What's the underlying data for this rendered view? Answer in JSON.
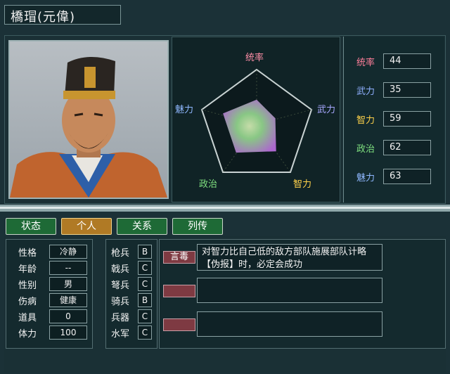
{
  "header": {
    "name": "橋瑁(元偉)"
  },
  "radar": {
    "labels": {
      "top": "统率",
      "right": "武力",
      "bottom_right": "智力",
      "bottom_left": "政治",
      "left": "魅力"
    },
    "values": {
      "统率": 44,
      "武力": 35,
      "智力": 59,
      "政治": 62,
      "魅力": 63
    }
  },
  "stats": [
    {
      "label": "统率",
      "value": "44",
      "color": "#ff7f9a"
    },
    {
      "label": "武力",
      "value": "35",
      "color": "#8fb0ff"
    },
    {
      "label": "智力",
      "value": "59",
      "color": "#ffd24a"
    },
    {
      "label": "政治",
      "value": "62",
      "color": "#7fe07f"
    },
    {
      "label": "魅力",
      "value": "63",
      "color": "#8fb8ff"
    }
  ],
  "tabs": [
    "状态",
    "个人",
    "关系",
    "列传"
  ],
  "active_tab": "个人",
  "personal": [
    {
      "label": "性格",
      "value": "冷静"
    },
    {
      "label": "年龄",
      "value": "--"
    },
    {
      "label": "性别",
      "value": "男"
    },
    {
      "label": "伤病",
      "value": "健康"
    },
    {
      "label": "道具",
      "value": "0"
    },
    {
      "label": "体力",
      "value": "100"
    }
  ],
  "troops": [
    {
      "label": "枪兵",
      "grade": "B"
    },
    {
      "label": "戟兵",
      "grade": "C"
    },
    {
      "label": "弩兵",
      "grade": "C"
    },
    {
      "label": "骑兵",
      "grade": "B"
    },
    {
      "label": "兵器",
      "grade": "C"
    },
    {
      "label": "水军",
      "grade": "C"
    }
  ],
  "skills": [
    {
      "name": "言毒",
      "desc": "对智力比自己低的敌方部队施展部队计略【伪报】时，必定会成功"
    },
    {
      "name": "",
      "desc": ""
    },
    {
      "name": "",
      "desc": ""
    }
  ],
  "colors": {
    "radar_top": "#ff8fa8",
    "radar_right": "#a8a8ff",
    "radar_bottom_right": "#ffd24a",
    "radar_bottom_left": "#7fe07f",
    "radar_left": "#8fb8ff"
  }
}
